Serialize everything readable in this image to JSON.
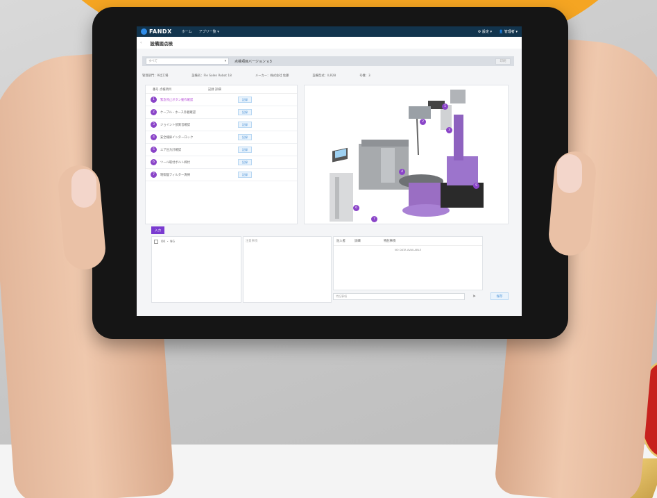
{
  "app": {
    "brand": "FANDX",
    "nav": [
      "ホーム",
      "アプリ一覧"
    ],
    "nav_dropdown_index": 1,
    "header_right": [
      "設定",
      "管理者"
    ]
  },
  "page": {
    "title": "設備図点検"
  },
  "toolbar": {
    "select_value": "すべて",
    "version_label": "点検項目バージョン v.3",
    "print_label": "印刷"
  },
  "info": {
    "department": "管理部門：R社工場",
    "equipment": "設備名：Fle Solen Robot 18",
    "maker": "メーカー：株式会社 佐藤",
    "model": "設備型式：ILR28",
    "count": "号機：3"
  },
  "list": {
    "headers": [
      "番号 点検項目",
      "記録 詳細"
    ],
    "items": [
      {
        "n": "1",
        "text": "緊急停止ボタン動作確認",
        "active": true
      },
      {
        "n": "2",
        "text": "ケーブル・ホース外観確認",
        "active": false
      },
      {
        "n": "3",
        "text": "ジョイント部異音確認",
        "active": false
      },
      {
        "n": "4",
        "text": "安全柵扉インターロック",
        "active": false
      },
      {
        "n": "5",
        "text": "エア圧力計確認",
        "active": false
      },
      {
        "n": "6",
        "text": "ツール取付ボルト締付",
        "active": false
      },
      {
        "n": "7",
        "text": "制御盤フィルター清掃",
        "active": false
      }
    ],
    "button_label": "記録"
  },
  "markers": [
    "1",
    "2",
    "3",
    "4",
    "5",
    "6",
    "7"
  ],
  "bottom": {
    "add_button": "入力",
    "checkbox_label": "OK ・ NG",
    "comment_placeholder": "注意事項",
    "table_headers": [
      "記入者",
      "詳細",
      "特記事項"
    ],
    "table_empty": "NO DATA AVAILABLE",
    "input_placeholder": "特記事項",
    "save_button": "保存"
  }
}
